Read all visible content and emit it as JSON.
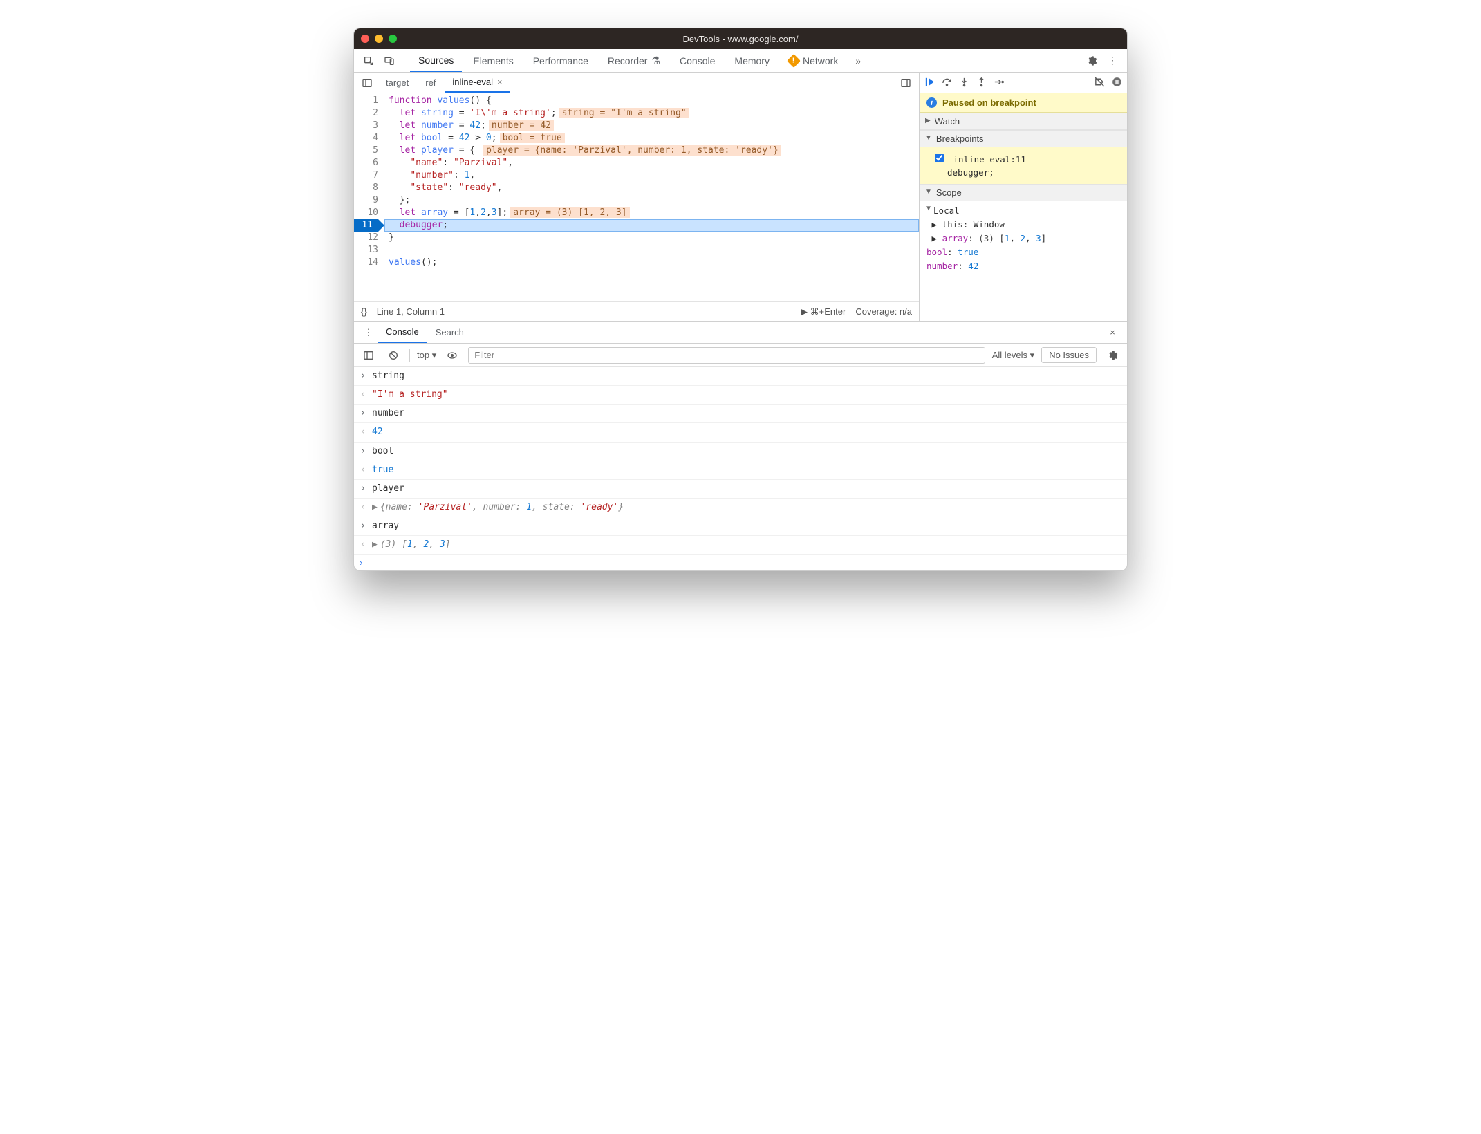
{
  "window": {
    "title": "DevTools - www.google.com/"
  },
  "tabs": {
    "items": [
      "Sources",
      "Elements",
      "Performance",
      "Recorder",
      "Console",
      "Memory",
      "Network"
    ],
    "active": "Sources"
  },
  "editorTabs": {
    "items": [
      "target",
      "ref",
      "inline-eval"
    ],
    "active": "inline-eval"
  },
  "code": {
    "lines": [
      {
        "n": 1,
        "html": "<span class='kw'>function</span> <span class='fn'>values</span>() {"
      },
      {
        "n": 2,
        "html": "  <span class='kw'>let</span> <span class='def'>string</span> = <span class='str'>'I\\'m a string'</span>;<span class='hint'>string = \"I'm a string\"</span>"
      },
      {
        "n": 3,
        "html": "  <span class='kw'>let</span> <span class='def'>number</span> = <span class='num'>42</span>;<span class='hint'>number = 42</span>"
      },
      {
        "n": 4,
        "html": "  <span class='kw'>let</span> <span class='def'>bool</span> = <span class='num'>42</span> &gt; <span class='num'>0</span>;<span class='hint'>bool = true</span>"
      },
      {
        "n": 5,
        "html": "  <span class='kw'>let</span> <span class='def'>player</span> = { <span class='hint'>player = {name: 'Parzival', number: 1, state: 'ready'}</span>"
      },
      {
        "n": 6,
        "html": "    <span class='prop'>\"name\"</span>: <span class='str'>\"Parzival\"</span>,"
      },
      {
        "n": 7,
        "html": "    <span class='prop'>\"number\"</span>: <span class='num'>1</span>,"
      },
      {
        "n": 8,
        "html": "    <span class='prop'>\"state\"</span>: <span class='str'>\"ready\"</span>,"
      },
      {
        "n": 9,
        "html": "  };"
      },
      {
        "n": 10,
        "html": "  <span class='kw'>let</span> <span class='def'>array</span> = [<span class='num'>1</span>,<span class='num'>2</span>,<span class='num'>3</span>];<span class='hint'>array = (3) [1, 2, 3]</span>"
      },
      {
        "n": 11,
        "html": "  <span class='kw' style='color:#a626a4'>debugger</span>;",
        "exec": true
      },
      {
        "n": 12,
        "html": "}"
      },
      {
        "n": 13,
        "html": ""
      },
      {
        "n": 14,
        "html": "<span class='fn'>values</span>();"
      }
    ],
    "breakpointLine": 11
  },
  "status": {
    "braces": "{}",
    "position": "Line 1, Column 1",
    "run": "⌘+Enter",
    "coverage": "Coverage: n/a"
  },
  "debugger": {
    "pauseMsg": "Paused on breakpoint",
    "watch": "Watch",
    "breakpoints_label": "Breakpoints",
    "breakpoint": {
      "label": "inline-eval:11",
      "code": "debugger;"
    },
    "scope_label": "Scope",
    "local_label": "Local",
    "scope": {
      "this": "Window",
      "array_repr": "(3) [1, 2, 3]",
      "bool": "true",
      "number": "42"
    }
  },
  "drawer": {
    "tabs": [
      "Console",
      "Search"
    ],
    "active": "Console",
    "ctx": "top",
    "filter_placeholder": "Filter",
    "levels": "All levels",
    "issues": "No Issues"
  },
  "console": {
    "entries": [
      {
        "dir": "in",
        "text": "string"
      },
      {
        "dir": "out",
        "html": "<span class='cstr'>\"I'm a string\"</span>"
      },
      {
        "dir": "in",
        "text": "number"
      },
      {
        "dir": "out",
        "html": "<span class='cnum'>42</span>"
      },
      {
        "dir": "in",
        "text": "bool"
      },
      {
        "dir": "out",
        "html": "<span class='ctrue'>true</span>"
      },
      {
        "dir": "in",
        "text": "player"
      },
      {
        "dir": "out",
        "expand": true,
        "html": "<span class='citalic'>{name: <span class='cstr' style='font-style:italic'>'Parzival'</span>, number: <span class='cnum' style='font-style:italic'>1</span>, state: <span class='cstr' style='font-style:italic'>'ready'</span>}</span>"
      },
      {
        "dir": "in",
        "text": "array"
      },
      {
        "dir": "out",
        "expand": true,
        "html": "<span class='citalic'>(3)</span> <span class='citalic' style='color:#848484'>[<span class='cnum'>1</span>, <span class='cnum'>2</span>, <span class='cnum'>3</span>]</span>"
      }
    ]
  }
}
